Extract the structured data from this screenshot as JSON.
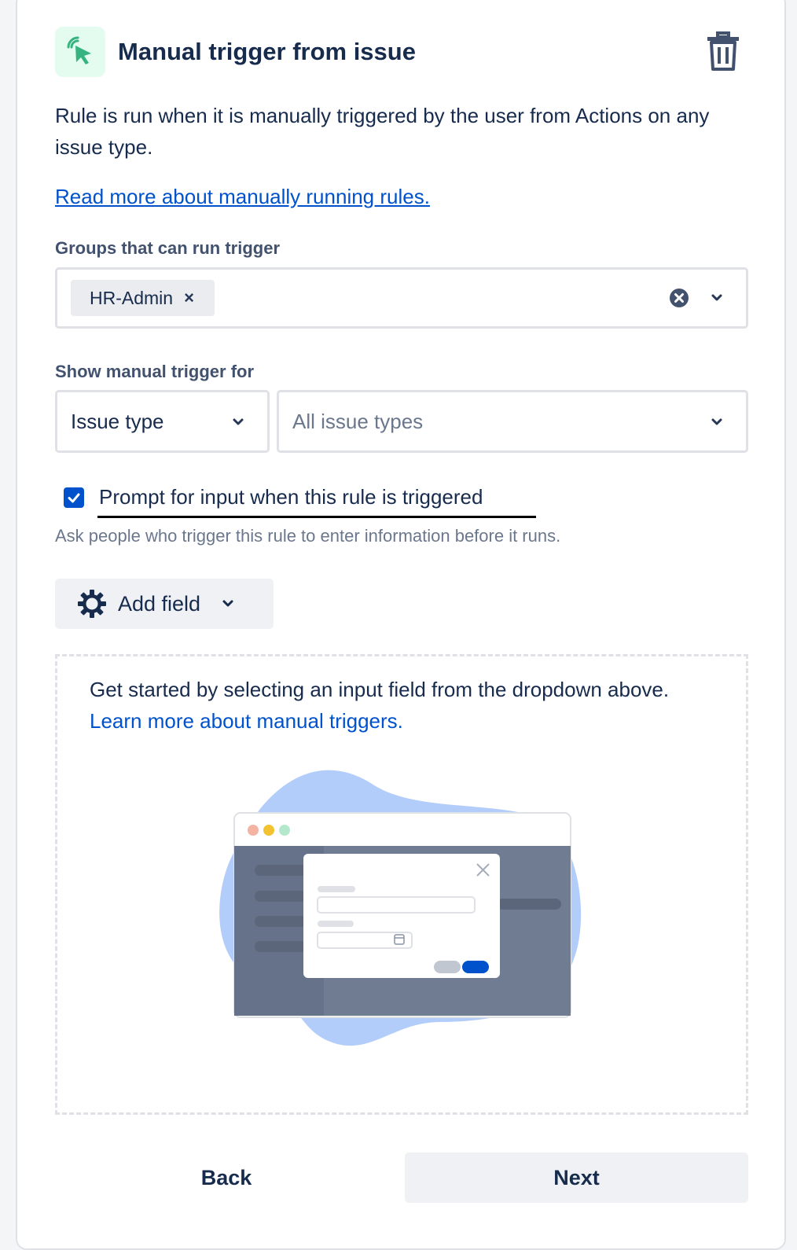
{
  "header": {
    "title": "Manual trigger from issue",
    "trigger_icon": "cursor-click-icon",
    "delete_icon": "trash-icon"
  },
  "description": "Rule is run when it is manually triggered by the user from Actions on any issue type.",
  "read_more_link": "Read more about manually running rules.",
  "groups": {
    "label": "Groups that can run trigger",
    "selected": [
      "HR-Admin"
    ],
    "remove_glyph": "×"
  },
  "show_for": {
    "label": "Show manual trigger for",
    "type_value": "Issue type",
    "issue_types_placeholder": "All issue types"
  },
  "prompt": {
    "checked": true,
    "label": "Prompt for input when this rule is triggered",
    "helper": "Ask people who trigger this rule to enter information before it runs."
  },
  "add_field": {
    "label": "Add field",
    "icon": "gear-icon"
  },
  "empty_state": {
    "text": "Get started by selecting an input field from the dropdown above.",
    "link": "Learn more about manual triggers."
  },
  "footer": {
    "back_label": "Back",
    "next_label": "Next"
  },
  "colors": {
    "brand_blue": "#0052cc",
    "icon_bg_green": "#e3fcef",
    "icon_green": "#36b37e",
    "text": "#172b4d"
  }
}
